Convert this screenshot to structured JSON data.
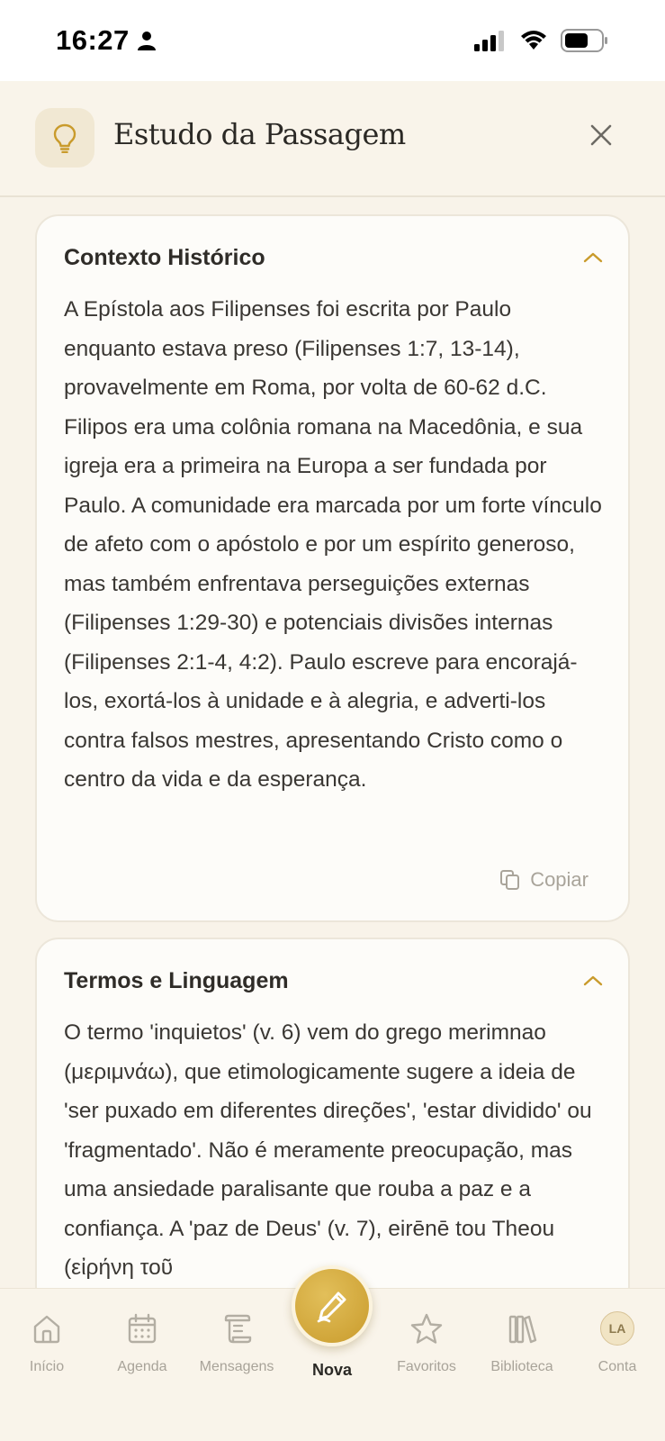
{
  "status_bar": {
    "time": "16:27"
  },
  "header": {
    "title": "Estudo da Passagem"
  },
  "cards": [
    {
      "title": "Contexto Histórico",
      "body": "A Epístola aos Filipenses foi escrita por Paulo enquanto estava preso (Filipenses 1:7, 13-14), provavelmente em Roma, por volta de 60-62 d.C. Filipos era uma colônia romana na Macedônia, e sua igreja era a primeira na Europa a ser fundada por Paulo. A comunidade era marcada por um forte vínculo de afeto com o apóstolo e por um espírito generoso, mas também enfrentava perseguições externas (Filipenses 1:29-30) e potenciais divisões internas (Filipenses 2:1-4, 4:2). Paulo escreve para encorajá-los, exortá-los à unidade e à alegria, e adverti-los contra falsos mestres, apresentando Cristo como o centro da vida e da esperança.",
      "copy_label": "Copiar"
    },
    {
      "title": "Termos e Linguagem",
      "body": "O termo 'inquietos' (v. 6) vem do grego merimnao (μεριμνάω), que etimologicamente sugere a ideia de 'ser puxado em diferentes direções', 'estar dividido' ou 'fragmentado'. Não é meramente preocupação, mas uma ansiedade paralisante que rouba a paz e a confiança. A 'paz de Deus' (v. 7), eirēnē tou Theou (εἰρήνη τοῦ"
    }
  ],
  "nav": {
    "items": [
      {
        "label": "Início",
        "icon": "home-icon"
      },
      {
        "label": "Agenda",
        "icon": "calendar-icon"
      },
      {
        "label": "Mensagens",
        "icon": "scroll-icon"
      },
      {
        "label": "Nova",
        "icon": "pen-icon"
      },
      {
        "label": "Favoritos",
        "icon": "star-icon"
      },
      {
        "label": "Biblioteca",
        "icon": "library-icon"
      },
      {
        "label": "Conta",
        "icon": "avatar",
        "initials": "LA"
      }
    ]
  },
  "colors": {
    "accent": "#c99b2c",
    "background": "#f8f3e9",
    "card": "#fdfcf9",
    "muted": "#a8a399"
  }
}
